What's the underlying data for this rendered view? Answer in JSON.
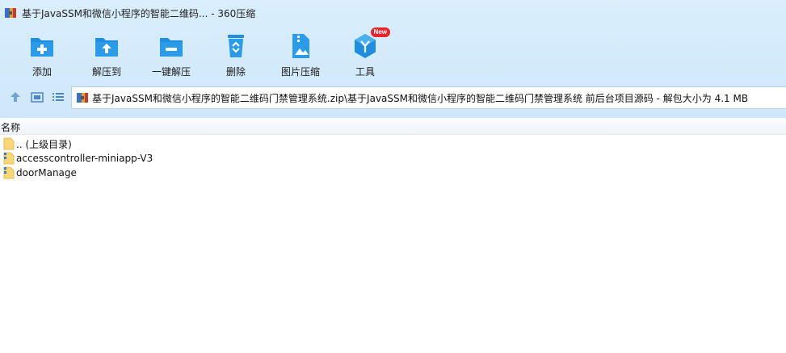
{
  "window": {
    "title": "基于JavaSSM和微信小程序的智能二维码... - 360压缩"
  },
  "toolbar": {
    "items": [
      {
        "label": "添加",
        "icon": "add-archive-icon"
      },
      {
        "label": "解压到",
        "icon": "extract-to-icon"
      },
      {
        "label": "一键解压",
        "icon": "one-click-extract-icon"
      },
      {
        "label": "删除",
        "icon": "recycle-bin-icon"
      },
      {
        "label": "图片压缩",
        "icon": "image-compress-icon"
      },
      {
        "label": "工具",
        "icon": "tools-cube-icon",
        "badge": "New"
      }
    ]
  },
  "nav": {
    "address": "基于JavaSSM和微信小程序的智能二维码门禁管理系统.zip\\基于JavaSSM和微信小程序的智能二维码门禁管理系统 前后台项目源码 - 解包大小为 4.1 MB"
  },
  "list": {
    "column_name": "名称",
    "rows": [
      {
        "name": ".. (上级目录)",
        "icon": "folder-icon"
      },
      {
        "name": "accesscontroller-miniapp-V3",
        "icon": "zipped-folder-icon"
      },
      {
        "name": "doorManage",
        "icon": "zipped-folder-icon"
      }
    ]
  },
  "colors": {
    "accent": "#1e8ee0",
    "toolbar_bg": "#d3eafb",
    "badge": "#e8242c"
  }
}
